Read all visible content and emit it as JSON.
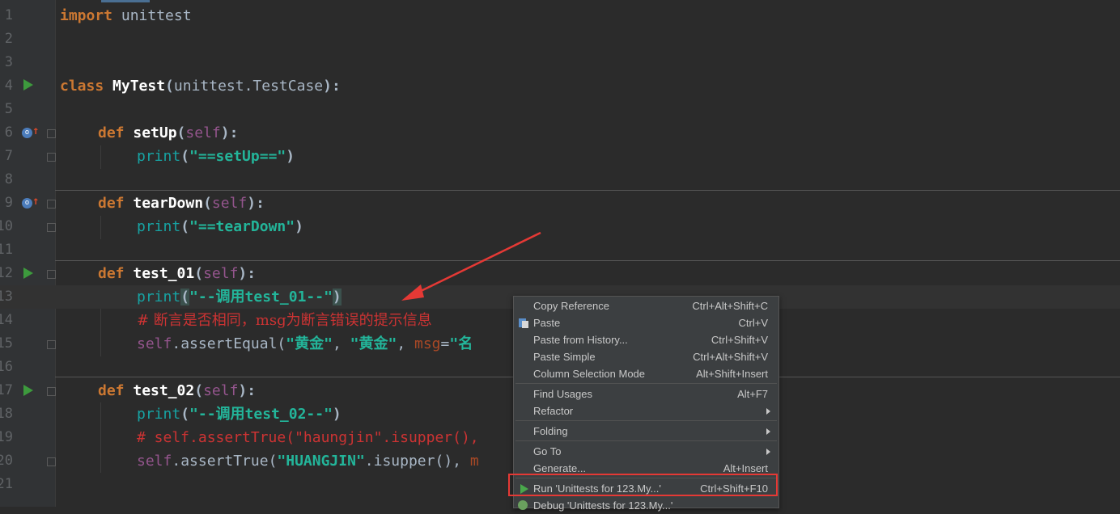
{
  "editor": {
    "lines": [
      {
        "n": "1"
      },
      {
        "n": "2"
      },
      {
        "n": "3"
      },
      {
        "n": "4"
      },
      {
        "n": "5"
      },
      {
        "n": "6"
      },
      {
        "n": "7"
      },
      {
        "n": "8"
      },
      {
        "n": "9"
      },
      {
        "n": "10"
      },
      {
        "n": "11"
      },
      {
        "n": "12"
      },
      {
        "n": "13"
      },
      {
        "n": "14"
      },
      {
        "n": "15"
      },
      {
        "n": "16"
      },
      {
        "n": "17"
      },
      {
        "n": "18"
      },
      {
        "n": "19"
      },
      {
        "n": "20"
      },
      {
        "n": "21"
      }
    ],
    "code": {
      "l1_kw": "import",
      "l1_rest": " unittest",
      "l4_kw": "class",
      "l4_name": " MyTest",
      "l4_paren_open": "(",
      "l4_base": "unittest.TestCase",
      "l4_end": "):",
      "l6_kw": "def",
      "l6_name": " setUp",
      "l6_open": "(",
      "l6_self": "self",
      "l6_end": "):",
      "l7_print": "print",
      "l7_open": "(",
      "l7_str": "\"==setUp==\"",
      "l7_close": ")",
      "l9_kw": "def",
      "l9_name": " tearDown",
      "l9_open": "(",
      "l9_self": "self",
      "l9_end": "):",
      "l10_print": "print",
      "l10_open": "(",
      "l10_str": "\"==tearDown\"",
      "l10_close": ")",
      "l12_kw": "def",
      "l12_name": " test_01",
      "l12_open": "(",
      "l12_self": "self",
      "l12_end": "):",
      "l13_print": "print",
      "l13_open": "(",
      "l13_str": "\"--调用test_01--\"",
      "l13_close": ")",
      "l14_comment": "# 断言是否相同，msg为断言错误的提示信息",
      "l15_self": "self",
      "l15_call": ".assertEqual(",
      "l15_s1": "\"黄金\"",
      "l15_comma1": ", ",
      "l15_s2": "\"黄金\"",
      "l15_comma2": ", ",
      "l15_kwarg": "msg",
      "l15_eq": "=",
      "l15_s3": "\"名",
      "l17_kw": "def",
      "l17_name": " test_02",
      "l17_open": "(",
      "l17_self": "self",
      "l17_end": "):",
      "l18_print": "print",
      "l18_open": "(",
      "l18_str": "\"--调用test_02--\"",
      "l18_close": ")",
      "l19_comment": "# self.assertTrue(\"haungjin\".isupper(),",
      "l20_self": "self",
      "l20_call": ".assertTrue(",
      "l20_str": "\"HUANGJIN\"",
      "l20_rest": ".isupper(), ",
      "l20_tail": "m"
    }
  },
  "context_menu": {
    "items": [
      {
        "label": "Copy Reference",
        "shortcut": "Ctrl+Alt+Shift+C"
      },
      {
        "label": "Paste",
        "shortcut": "Ctrl+V"
      },
      {
        "label": "Paste from History...",
        "shortcut": "Ctrl+Shift+V"
      },
      {
        "label": "Paste Simple",
        "shortcut": "Ctrl+Alt+Shift+V"
      },
      {
        "label": "Column Selection Mode",
        "shortcut": "Alt+Shift+Insert"
      },
      {
        "label": "Find Usages",
        "shortcut": "Alt+F7"
      },
      {
        "label": "Refactor",
        "shortcut": ""
      },
      {
        "label": "Folding",
        "shortcut": ""
      },
      {
        "label": "Go To",
        "shortcut": ""
      },
      {
        "label": "Generate...",
        "shortcut": "Alt+Insert"
      },
      {
        "label": "Run 'Unittests for 123.My...'",
        "shortcut": "Ctrl+Shift+F10"
      },
      {
        "label": "Debug 'Unittests for 123.My...'",
        "shortcut": ""
      }
    ]
  },
  "colors": {
    "highlight_box": "#e53935",
    "annotation_arrow": "#e53935",
    "run_icon": "#49a84b"
  },
  "icons": [
    "run-gutter-icon",
    "override-icon",
    "fold-icon",
    "paste-icon",
    "run-icon",
    "debug-icon",
    "submenu-arrow-icon"
  ]
}
